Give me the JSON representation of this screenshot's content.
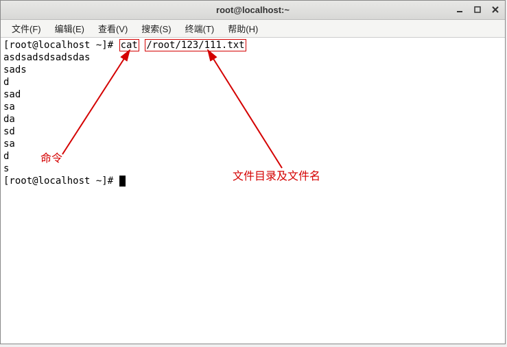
{
  "window": {
    "title": "root@localhost:~"
  },
  "menu": {
    "items": [
      "文件(F)",
      "编辑(E)",
      "查看(V)",
      "搜索(S)",
      "终端(T)",
      "帮助(H)"
    ]
  },
  "terminal": {
    "prompt_prefix": "[root@localhost ~]# ",
    "command": "cat",
    "filepath": "/root/123/111.txt",
    "output_lines": [
      "asdsadsdsadsdas",
      "sads",
      "d",
      "sad",
      "sa",
      "da",
      "sd",
      "sa",
      "d",
      "s"
    ],
    "prompt2": "[root@localhost ~]# "
  },
  "annotations": {
    "command_label": "命令",
    "filepath_label": "文件目录及文件名"
  }
}
